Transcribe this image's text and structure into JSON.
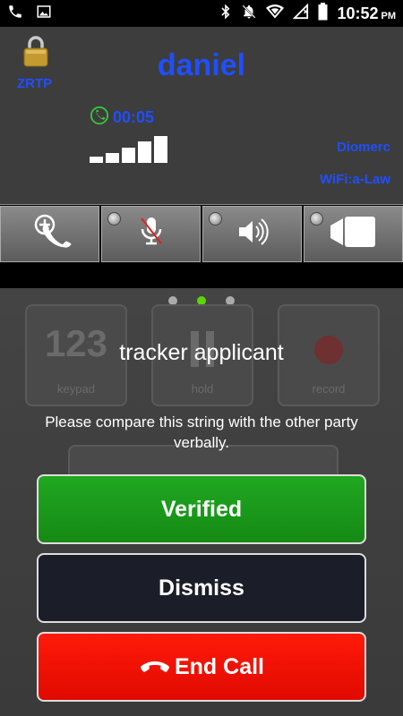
{
  "status_bar": {
    "time": "10:52",
    "ampm": "PM"
  },
  "call": {
    "security_label": "ZRTP",
    "caller_name": "daniel",
    "duration": "00:05",
    "signal_level": 5,
    "codec_primary": "Diomerc",
    "codec_secondary": "WiFi:a-Law"
  },
  "controls": [
    {
      "name": "add-call",
      "icon": "add-call-icon"
    },
    {
      "name": "mute",
      "icon": "mic-muted-icon"
    },
    {
      "name": "speaker",
      "icon": "speaker-icon"
    },
    {
      "name": "video",
      "icon": "video-camera-icon"
    }
  ],
  "background_keys": {
    "keypad": {
      "big": "123",
      "label": "keypad"
    },
    "hold": {
      "label": "hold"
    },
    "record": {
      "label": "record"
    }
  },
  "sas_dialog": {
    "sas_string": "tracker applicant",
    "message": "Please compare this string with the other party verbally.",
    "verified_label": "Verified",
    "dismiss_label": "Dismiss",
    "end_call_label": "End Call"
  },
  "colors": {
    "accent_blue": "#1f4fff",
    "verified_green": "#1a9a1a",
    "end_red": "#ff1a0a"
  }
}
